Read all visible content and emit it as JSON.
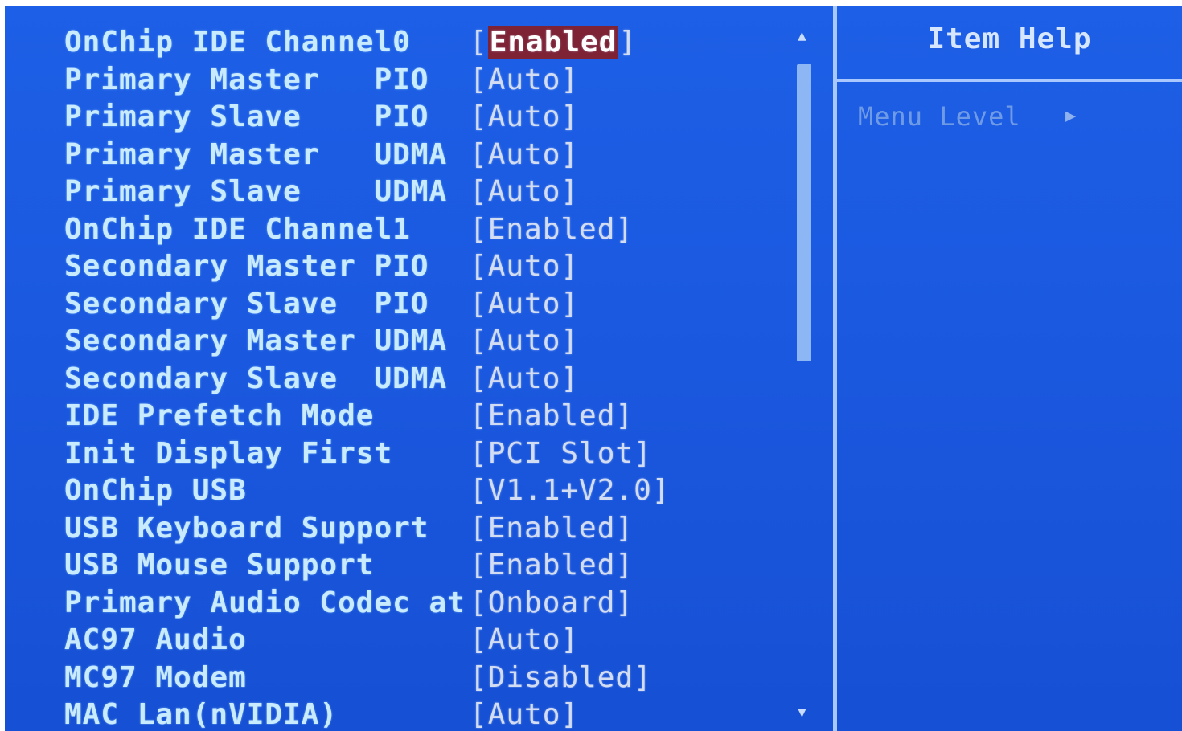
{
  "settings": {
    "rows": [
      {
        "label": "OnChip IDE Channel0",
        "value": "Enabled"
      },
      {
        "label": "Primary Master   PIO",
        "value": "Auto"
      },
      {
        "label": "Primary Slave    PIO",
        "value": "Auto"
      },
      {
        "label": "Primary Master   UDMA",
        "value": "Auto"
      },
      {
        "label": "Primary Slave    UDMA",
        "value": "Auto"
      },
      {
        "label": "OnChip IDE Channel1",
        "value": "Enabled"
      },
      {
        "label": "Secondary Master PIO",
        "value": "Auto"
      },
      {
        "label": "Secondary Slave  PIO",
        "value": "Auto"
      },
      {
        "label": "Secondary Master UDMA",
        "value": "Auto"
      },
      {
        "label": "Secondary Slave  UDMA",
        "value": "Auto"
      },
      {
        "label": "IDE Prefetch Mode",
        "value": "Enabled"
      },
      {
        "label": "Init Display First",
        "value": "PCI Slot"
      },
      {
        "label": "OnChip USB",
        "value": "V1.1+V2.0"
      },
      {
        "label": "USB Keyboard Support",
        "value": "Enabled"
      },
      {
        "label": "USB Mouse Support",
        "value": "Enabled"
      },
      {
        "label": "Primary Audio Codec at",
        "value": "Onboard"
      },
      {
        "label": "AC97 Audio",
        "value": "Auto"
      },
      {
        "label": "MC97 Modem",
        "value": "Disabled"
      },
      {
        "label": "MAC Lan(nVIDIA)",
        "value": "Auto"
      }
    ]
  },
  "scrollbar": {
    "up_glyph": "▲",
    "down_glyph": "▼"
  },
  "help": {
    "title": "Item Help",
    "menu_level_label": "Menu Level",
    "menu_level_glyph": "▶"
  },
  "colors": {
    "background": "#1a58df",
    "label_text": "#c9ebff",
    "value_text": "#d2dcf2",
    "selected_value_bg": "#7e2236",
    "divider": "#a9c8ff"
  }
}
